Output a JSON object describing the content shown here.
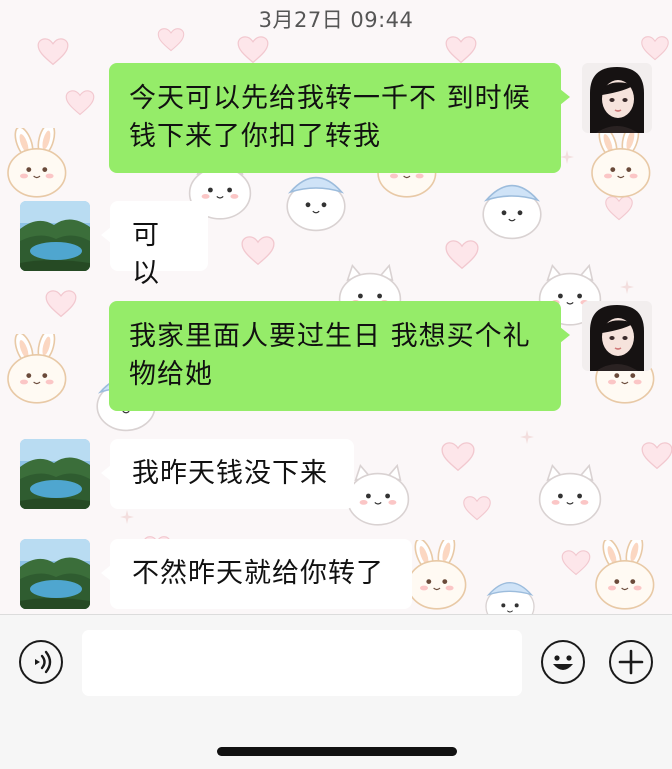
{
  "header": {
    "timestamp": "3月27日 09:44"
  },
  "messages": [
    {
      "direction": "sent",
      "avatar": "girl-avatar",
      "lines": [
        "今天可以先给我转一千不 到时候",
        "钱下来了你扣了转我"
      ]
    },
    {
      "direction": "received",
      "avatar": "lake-avatar",
      "lines": [
        "可以"
      ]
    },
    {
      "direction": "sent",
      "avatar": "girl-avatar",
      "lines": [
        "我家里面人要过生日 我想买个礼",
        "物给她"
      ]
    },
    {
      "direction": "received",
      "avatar": "lake-avatar",
      "lines": [
        "我昨天钱没下来"
      ]
    },
    {
      "direction": "received",
      "avatar": "lake-avatar",
      "lines": [
        "不然昨天就给你转了"
      ]
    }
  ],
  "input_bar": {
    "voice_icon": "voice-icon",
    "text_value": "",
    "emoji_icon": "emoji-icon",
    "plus_icon": "plus-icon"
  },
  "colors": {
    "sent_bubble": "#95ec69",
    "received_bubble": "#ffffff",
    "input_bar_bg": "#f6f6f6"
  }
}
